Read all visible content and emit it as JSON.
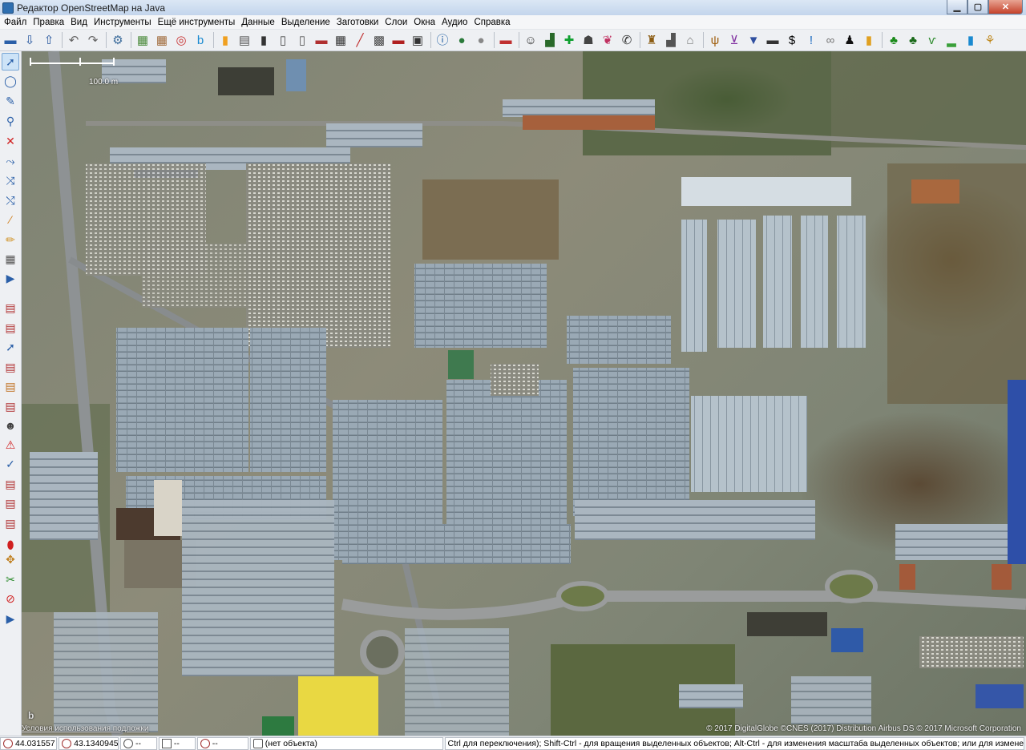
{
  "window": {
    "title": "Редактор OpenStreetMap на Java",
    "min_glyph": "▁",
    "max_glyph": "▢",
    "close_glyph": "✕"
  },
  "menu": [
    "Файл",
    "Правка",
    "Вид",
    "Инструменты",
    "Ещё инструменты",
    "Данные",
    "Выделение",
    "Заготовки",
    "Слои",
    "Окна",
    "Аудио",
    "Справка"
  ],
  "toolbar": [
    {
      "name": "open-icon",
      "glyph": "▬",
      "color": "#2a5fa8"
    },
    {
      "name": "download-icon",
      "glyph": "⇩",
      "color": "#1d4f9a"
    },
    {
      "name": "upload-icon",
      "glyph": "⇧",
      "color": "#1d4f9a"
    },
    {
      "sep": true
    },
    {
      "name": "undo-icon",
      "glyph": "↶",
      "color": "#666"
    },
    {
      "name": "redo-icon",
      "glyph": "↷",
      "color": "#666"
    },
    {
      "sep": true
    },
    {
      "name": "preferences-icon",
      "glyph": "⚙",
      "color": "#3a6a9a"
    },
    {
      "sep": true
    },
    {
      "name": "imagery-icon-1",
      "glyph": "▦",
      "color": "#4a8a3a"
    },
    {
      "name": "imagery-icon-2",
      "glyph": "▦",
      "color": "#a06a3a"
    },
    {
      "name": "imagery-icon-3",
      "glyph": "◎",
      "color": "#c83232"
    },
    {
      "name": "bing-icon",
      "glyph": "b",
      "color": "#1a8ad0"
    },
    {
      "sep": true
    },
    {
      "name": "traffic-light-icon",
      "glyph": "▮",
      "color": "#f0a020"
    },
    {
      "name": "barrier-icon",
      "glyph": "▤",
      "color": "#555"
    },
    {
      "name": "parking-icon",
      "glyph": "▮",
      "color": "#333"
    },
    {
      "name": "door-icon",
      "glyph": "▯",
      "color": "#444"
    },
    {
      "name": "crossing-icon",
      "glyph": "▯",
      "color": "#555"
    },
    {
      "name": "house-icon",
      "glyph": "▬",
      "color": "#b03030"
    },
    {
      "name": "railway-icon",
      "glyph": "▦",
      "color": "#333"
    },
    {
      "name": "line-icon",
      "glyph": "╱",
      "color": "#c03030"
    },
    {
      "name": "grid-icon",
      "glyph": "▩",
      "color": "#444"
    },
    {
      "name": "building-icon",
      "glyph": "▬",
      "color": "#b02020"
    },
    {
      "name": "car-icon",
      "glyph": "▣",
      "color": "#333"
    },
    {
      "sep": true
    },
    {
      "name": "info-icon",
      "glyph": "ⓘ",
      "color": "#1a5aa0"
    },
    {
      "name": "globe-icon",
      "glyph": "●",
      "color": "#2a7a3a"
    },
    {
      "name": "search-icon",
      "glyph": "●",
      "color": "#888"
    },
    {
      "sep": true
    },
    {
      "name": "flag-icon",
      "glyph": "▬",
      "color": "#c03030"
    },
    {
      "sep": true
    },
    {
      "name": "theatre-icon",
      "glyph": "☺",
      "color": "#333"
    },
    {
      "name": "picnic-icon",
      "glyph": "▟",
      "color": "#2a6a2a"
    },
    {
      "name": "health-icon",
      "glyph": "✚",
      "color": "#10a030"
    },
    {
      "name": "vehicle-icon",
      "glyph": "☗",
      "color": "#444"
    },
    {
      "name": "balloons-icon",
      "glyph": "❦",
      "color": "#c03060"
    },
    {
      "name": "phone-icon",
      "glyph": "✆",
      "color": "#333"
    },
    {
      "sep": true
    },
    {
      "name": "castle-icon",
      "glyph": "♜",
      "color": "#8a5a10"
    },
    {
      "name": "factory-icon",
      "glyph": "▟",
      "color": "#555"
    },
    {
      "name": "home-icon",
      "glyph": "⌂",
      "color": "#777"
    },
    {
      "sep": true
    },
    {
      "name": "restaurant-icon",
      "glyph": "ψ",
      "color": "#a06010"
    },
    {
      "name": "shop-cart-icon",
      "glyph": "⊻",
      "color": "#8030a0"
    },
    {
      "name": "clothes-icon",
      "glyph": "▼",
      "color": "#3050a0"
    },
    {
      "name": "electronics-icon",
      "glyph": "▬",
      "color": "#333"
    },
    {
      "name": "money-icon",
      "glyph": "$",
      "color": "#000"
    },
    {
      "name": "info-point-icon",
      "glyph": "!",
      "color": "#1a6ac0"
    },
    {
      "name": "link-icon",
      "glyph": "∞",
      "color": "#777"
    },
    {
      "name": "person-icon",
      "glyph": "♟",
      "color": "#111"
    },
    {
      "name": "bag-icon",
      "glyph": "▮",
      "color": "#e0a020"
    },
    {
      "sep": true
    },
    {
      "name": "tree-icon",
      "glyph": "♣",
      "color": "#1a8a1a"
    },
    {
      "name": "forest-icon",
      "glyph": "♣",
      "color": "#1a6a1a"
    },
    {
      "name": "grass-icon",
      "glyph": "ⱱ",
      "color": "#2a8a2a"
    },
    {
      "name": "meadow-icon",
      "glyph": "▂",
      "color": "#3aa03a"
    },
    {
      "name": "water-icon",
      "glyph": "▮",
      "color": "#1a8ad0"
    },
    {
      "name": "wheat-icon",
      "glyph": "⚘",
      "color": "#c08a20"
    }
  ],
  "lefttools": [
    {
      "name": "select-tool-icon",
      "glyph": "➚",
      "color": "#2a5fa8",
      "active": true
    },
    {
      "name": "lasso-tool-icon",
      "glyph": "◯",
      "color": "#2a5fa8"
    },
    {
      "name": "draw-tool-icon",
      "glyph": "✎",
      "color": "#2a5fa8"
    },
    {
      "name": "zoom-tool-icon",
      "glyph": "⚲",
      "color": "#2a5fa8"
    },
    {
      "name": "delete-tool-icon",
      "glyph": "✕",
      "color": "#d02020"
    },
    {
      "name": "split-way-icon",
      "glyph": "⤳",
      "color": "#2a5fa8"
    },
    {
      "name": "combine-way-icon",
      "glyph": "⤨",
      "color": "#2a5fa8"
    },
    {
      "name": "parallel-way-icon",
      "glyph": "⤭",
      "color": "#2a5fa8"
    },
    {
      "name": "ruler-icon",
      "glyph": "⁄",
      "color": "#d08020"
    },
    {
      "name": "pencil-icon",
      "glyph": "✏",
      "color": "#d09020"
    },
    {
      "name": "building-tool-icon",
      "glyph": "▦",
      "color": "#555"
    },
    {
      "name": "more-tools-icon",
      "glyph": "▶",
      "color": "#2a5fa8"
    },
    {
      "name": "layers-panel-icon",
      "glyph": "▤",
      "color": "#b03030"
    },
    {
      "name": "properties-panel-icon",
      "glyph": "▤",
      "color": "#b03030"
    },
    {
      "name": "selection-panel-icon",
      "glyph": "➚",
      "color": "#2a5fa8"
    },
    {
      "name": "relations-panel-icon",
      "glyph": "▤",
      "color": "#b03030"
    },
    {
      "name": "filters-panel-icon",
      "glyph": "▤",
      "color": "#c07020"
    },
    {
      "name": "changeset-panel-icon",
      "glyph": "▤",
      "color": "#b03030"
    },
    {
      "name": "author-panel-icon",
      "glyph": "☻",
      "color": "#444"
    },
    {
      "name": "validation-panel-icon",
      "glyph": "⚠",
      "color": "#d02020"
    },
    {
      "name": "commands-panel-icon",
      "glyph": "✓",
      "color": "#2a5fa8"
    },
    {
      "name": "notes-panel-icon",
      "glyph": "▤",
      "color": "#b03030"
    },
    {
      "name": "conflict-panel-icon",
      "glyph": "▤",
      "color": "#b03030"
    },
    {
      "name": "history-panel-icon",
      "glyph": "▤",
      "color": "#b03030"
    },
    {
      "name": "map-marker-icon",
      "glyph": "⬮",
      "color": "#d02020"
    },
    {
      "name": "imagery-offset-icon",
      "glyph": "✥",
      "color": "#c08020"
    },
    {
      "name": "mapillary-icon",
      "glyph": "✂",
      "color": "#2a8a2a"
    },
    {
      "name": "speed-icon",
      "glyph": "⊘",
      "color": "#d02020"
    },
    {
      "name": "expand-panel-icon",
      "glyph": "▶",
      "color": "#2a5fa8"
    }
  ],
  "map": {
    "scale_label": "100.0 m",
    "terms": "Условия использования подложки",
    "copyright": "© 2017 DigitalGlobe ©CNES (2017) Distribution Airbus DS © 2017 Microsoft Corporation",
    "logo": "b"
  },
  "status": {
    "lat": "44.031557",
    "lon": "43.1340945",
    "heading": "--",
    "angle": "--",
    "distance": "--",
    "selection": "(нет объекта)",
    "hint": "Ctrl для переключения); Shift-Ctrl - для вращения выделенных объектов; Alt-Ctrl - для изменения масштаба выделенных объектов; или для изменения выделения"
  }
}
